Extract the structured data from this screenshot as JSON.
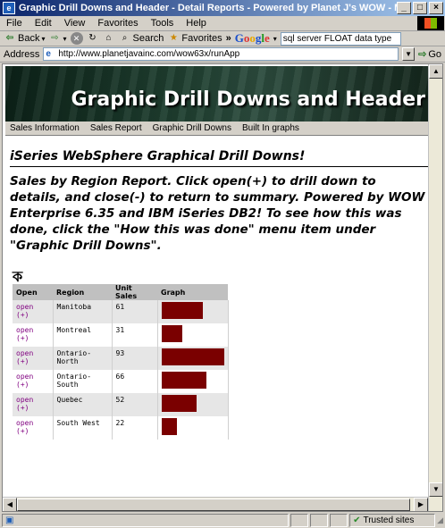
{
  "window": {
    "title": "Graphic Drill Downs and Header - Detail Reports - Powered by Planet J's WOW - Microsoft Internet Explorer",
    "minimize": "_",
    "maximize": "□",
    "close": "×"
  },
  "menubar": {
    "items": [
      "File",
      "Edit",
      "View",
      "Favorites",
      "Tools",
      "Help"
    ]
  },
  "toolbar": {
    "back_label": "Back",
    "search_label": "Search",
    "favorites_label": "Favorites",
    "more_label": "»",
    "google_search_value": "sql server FLOAT data type"
  },
  "addressbar": {
    "label": "Address",
    "url": "http://www.planetjavainc.com/wow63x/runApp",
    "go_label": "Go"
  },
  "page": {
    "banner_title": "Graphic Drill Downs and Header",
    "nav": [
      "Sales Information",
      "Sales Report",
      "Graphic Drill Downs",
      "Built In graphs"
    ],
    "heading": "iSeries WebSphere Graphical Drill Downs!",
    "description": "Sales by Region Report. Click open(+) to drill down to details, and close(-) to return to summary. Powered by WOW Enterprise 6.35 and IBM iSeries DB2! To see how this was done, click the \"How this was done\" menu item under \"Graphic Drill Downs\".",
    "chart_icon": "ক"
  },
  "table": {
    "headers": {
      "open": "Open",
      "region": "Region",
      "units": "Unit Sales",
      "graph": "Graph"
    },
    "max_units": 93,
    "rows": [
      {
        "open": "open (+)",
        "region": "Manitoba",
        "units": "61",
        "value": 61
      },
      {
        "open": "open (+)",
        "region": "Montreal",
        "units": "31",
        "value": 31
      },
      {
        "open": "open (+)",
        "region": "Ontario-North",
        "units": "93",
        "value": 93
      },
      {
        "open": "open (+)",
        "region": "Ontario-South",
        "units": "66",
        "value": 66
      },
      {
        "open": "open (+)",
        "region": "Quebec",
        "units": "52",
        "value": 52
      },
      {
        "open": "open (+)",
        "region": "South West",
        "units": "22",
        "value": 22
      }
    ],
    "bar_color": "#7a0000"
  },
  "statusbar": {
    "zone": "Trusted sites"
  }
}
